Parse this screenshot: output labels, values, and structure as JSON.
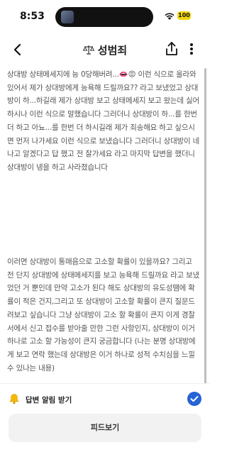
{
  "status_bar": {
    "time": "8:53",
    "battery": "100",
    "battery_color": "#f2d50c"
  },
  "header": {
    "title": "성범죄",
    "title_icon": "scale-icon"
  },
  "post": {
    "paragraph1": "상대방 상태메세지에 능 0당해버려...👄😡 이런 식으로 올라와있어서 제가 상대방에게 능욕해 드릴까요?? 라고 보냈었고 상대방이 하...하길래 제가 상대방 보고 상태메세지 보고 왔는데 싫어하시나 이런 식으로 말했습니다 그러더니 상대방이 하...를 한번 더 하고 아뇨...를 한번 더 하시길래 제가 죄송해요 하고 싶으시면 먼저 나가세요 이런 식으로 보냈습니다 그러더니 상대방이 네 나고 알겠다고 답 했고 전 잘가세요 라고 마지막 답변을 했더니 상대방이 넹을 하고 사라졌습니다",
    "paragraph2": "이러면 상대방이 통매음으로 고소할 확률이 있을까요? 그리고 전 단지 상대방에 상태메세지를 보고 능욕해 드릴까요 라고 보냈었던 거 뿐인데 만약 고소가 된다 해도 상대방의 유도성땜에 확률이 적은 건지,그리고 또 상대방이 고소할 확률이 큰지 질문드려보고 싶습니다 그냥 상대방이 고소 할 확률이 큰지 이게 경찰서에서 신고 접수를 받아줄 만한 그런 사항인지, 상대방이 이거 하나로 고소 할 가능성이 큰지 궁금합니다 (나는 분명 상대방에게 보고 연락 했는데 상대방은 이거 하나로 성적 수치심을 느낄 수 있나는 내용)"
  },
  "bottom": {
    "notify_label": "답변 알림 받기",
    "notify_checked": true,
    "accent": "#2563d6",
    "feed_button": "피드보기"
  }
}
